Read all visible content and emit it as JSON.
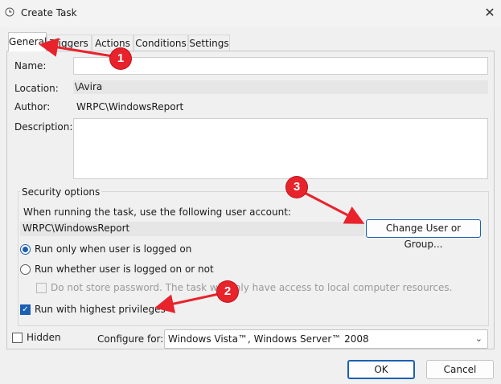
{
  "window": {
    "title": "Create Task",
    "close_glyph": "✕"
  },
  "tabs": [
    {
      "label": "General",
      "active": true
    },
    {
      "label": "Triggers",
      "active": false
    },
    {
      "label": "Actions",
      "active": false
    },
    {
      "label": "Conditions",
      "active": false
    },
    {
      "label": "Settings",
      "active": false
    }
  ],
  "general": {
    "name_label": "Name:",
    "name_value": "",
    "location_label": "Location:",
    "location_value": "\\Avira",
    "author_label": "Author:",
    "author_value": "WRPC\\WindowsReport",
    "description_label": "Description:",
    "description_value": ""
  },
  "security": {
    "group_title": "Security options",
    "account_prompt": "When running the task, use the following user account:",
    "account_value": "WRPC\\WindowsReport",
    "change_button": "Change User or Group...",
    "radio_logged_on": "Run only when user is logged on",
    "radio_logged_on_or_not": "Run whether user is logged on or not",
    "do_not_store_password": "Do not store password.  The task will only have access to local computer resources.",
    "highest_privileges": "Run with highest privileges",
    "selected_radio": "Run only when user is logged on",
    "highest_privileges_checked": true,
    "do_not_store_checked": false
  },
  "bottom": {
    "hidden_label": "Hidden",
    "hidden_checked": false,
    "configure_label": "Configure for:",
    "configure_value": "Windows Vista™, Windows Server™ 2008"
  },
  "footer": {
    "ok": "OK",
    "cancel": "Cancel"
  },
  "annotations": [
    {
      "number": "1",
      "points_to": "General tab"
    },
    {
      "number": "2",
      "points_to": "Run with highest privileges"
    },
    {
      "number": "3",
      "points_to": "Change User or Group..."
    }
  ],
  "colors": {
    "accent": "#1b5fb5",
    "annotation_red": "#e8232c"
  },
  "icons": {
    "title": "clock-icon",
    "close": "close-icon",
    "dropdown": "chevron-down-icon",
    "checkmark": "checkmark-icon"
  }
}
